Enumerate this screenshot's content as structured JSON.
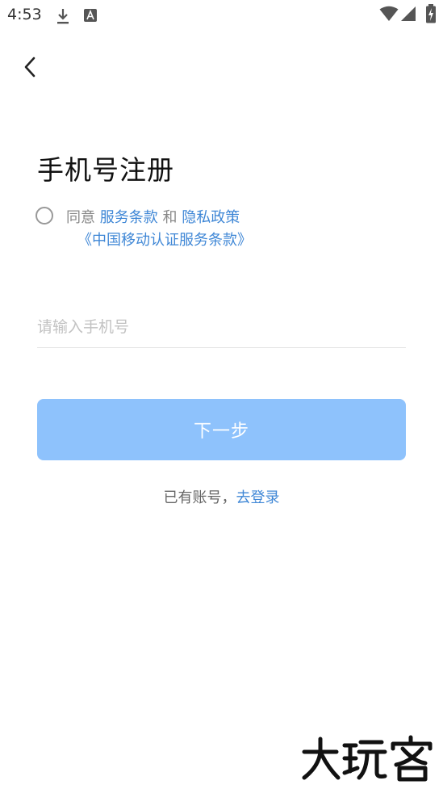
{
  "status_bar": {
    "time": "4:53",
    "icons": [
      "download-icon",
      "font-icon",
      "wifi-icon",
      "signal-icon",
      "battery-charging-icon"
    ]
  },
  "nav": {
    "back_icon": "chevron-left-icon"
  },
  "page": {
    "title": "手机号注册",
    "agreement": {
      "prefix": "同意",
      "service_terms": "服务条款",
      "conjunction": "和",
      "privacy_policy": "隐私政策",
      "cmcc_terms": "《中国移动认证服务条款》"
    },
    "phone_input": {
      "placeholder": "请输入手机号",
      "value": ""
    },
    "next_button": "下一步",
    "login_prompt": {
      "text": "已有账号，",
      "link": "去登录"
    }
  },
  "watermark": {
    "text": "大玩客"
  },
  "colors": {
    "accent": "#3f87d6",
    "button_disabled": "#8ec2fc",
    "text_gray": "#888888",
    "placeholder": "#c2c2c2"
  }
}
